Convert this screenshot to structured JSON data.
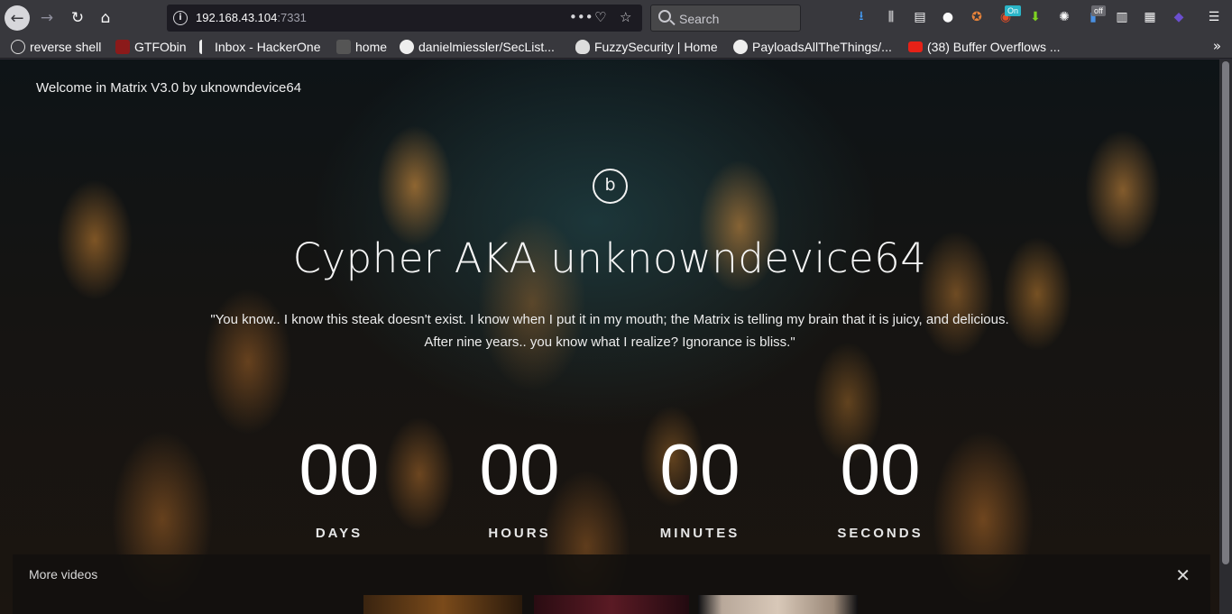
{
  "browser": {
    "url_host": "192.168.43.104",
    "url_port": ":7331",
    "search_placeholder": "Search",
    "badge_on": "On",
    "badge_off": "off",
    "bookmarks": [
      {
        "label": "reverse shell"
      },
      {
        "label": "GTFObin"
      },
      {
        "label": "Inbox - HackerOne"
      },
      {
        "label": "home"
      },
      {
        "label": "danielmiessler/SecList..."
      },
      {
        "label": "FuzzySecurity | Home"
      },
      {
        "label": "PayloadsAllTheThings/..."
      },
      {
        "label": "(38) Buffer Overflows ..."
      }
    ]
  },
  "page": {
    "welcome": "Welcome in Matrix V3.0 by uknowndevice64",
    "logo_letter": "b",
    "headline": "Cypher AKA unknowndevice64",
    "quote_line1": "\"You know.. I know this steak doesn't exist. I know when I put it in my mouth; the Matrix is telling my brain that it is juicy, and delicious.",
    "quote_line2": "After nine years.. you know what I realize? Ignorance is bliss.\"",
    "countdown": [
      {
        "value": "00",
        "label": "DAYS"
      },
      {
        "value": "00",
        "label": "HOURS"
      },
      {
        "value": "00",
        "label": "MINUTES"
      },
      {
        "value": "00",
        "label": "SECONDS"
      }
    ],
    "more_videos": {
      "title": "More videos",
      "close": "✕"
    }
  },
  "colors": {
    "chrome": "#38383d",
    "url_bg": "#1c1b22",
    "text": "#f9f9fa",
    "countdown_text": "#ffffff"
  }
}
